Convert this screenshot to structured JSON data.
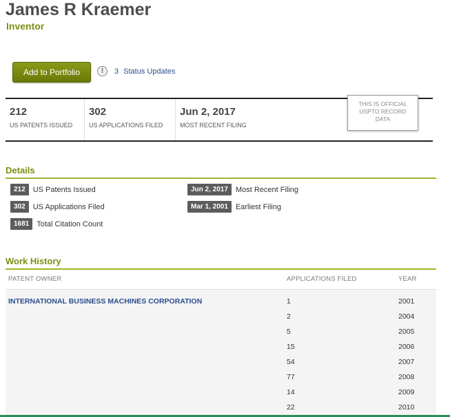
{
  "profile": {
    "name": "James R Kraemer",
    "role": "Inventor"
  },
  "actions": {
    "add_portfolio": "Add to Portfolio",
    "status_count": "3",
    "status_label": "Status Updates",
    "alert_glyph": "!"
  },
  "stats": [
    {
      "value": "212",
      "label": "US PATENTS ISSUED"
    },
    {
      "value": "302",
      "label": "US APPLICATIONS FILED"
    },
    {
      "value": "Jun 2, 2017",
      "label": "MOST RECENT FILING"
    }
  ],
  "official": {
    "line1": "THIS IS OFFICIAL",
    "line2": "USPTO RECORD",
    "line3": "DATA"
  },
  "details": {
    "title": "Details",
    "items": [
      {
        "tag": "212",
        "label": "US Patents Issued"
      },
      {
        "tag": "302",
        "label": "US Applications Filed"
      },
      {
        "tag": "1681",
        "label": "Total Citation Count"
      },
      {
        "tag": "Jun 2, 2017",
        "label": "Most Recent Filing"
      },
      {
        "tag": "Mar 1, 2001",
        "label": "Earliest Filing"
      }
    ]
  },
  "work_history": {
    "title": "Work History",
    "headers": {
      "owner": "PATENT OWNER",
      "apps": "APPLICATIONS FILED",
      "year": "YEAR"
    },
    "owner": "INTERNATIONAL BUSINESS MACHINES CORPORATION",
    "rows": [
      {
        "apps": "1",
        "year": "2001"
      },
      {
        "apps": "2",
        "year": "2004"
      },
      {
        "apps": "5",
        "year": "2005"
      },
      {
        "apps": "15",
        "year": "2006"
      },
      {
        "apps": "54",
        "year": "2007"
      },
      {
        "apps": "77",
        "year": "2008"
      },
      {
        "apps": "14",
        "year": "2009"
      },
      {
        "apps": "22",
        "year": "2010"
      }
    ]
  },
  "colors": {
    "accent": "#7a8f12",
    "link": "#2a4d8f",
    "tag_bg": "#5c5c5c"
  }
}
